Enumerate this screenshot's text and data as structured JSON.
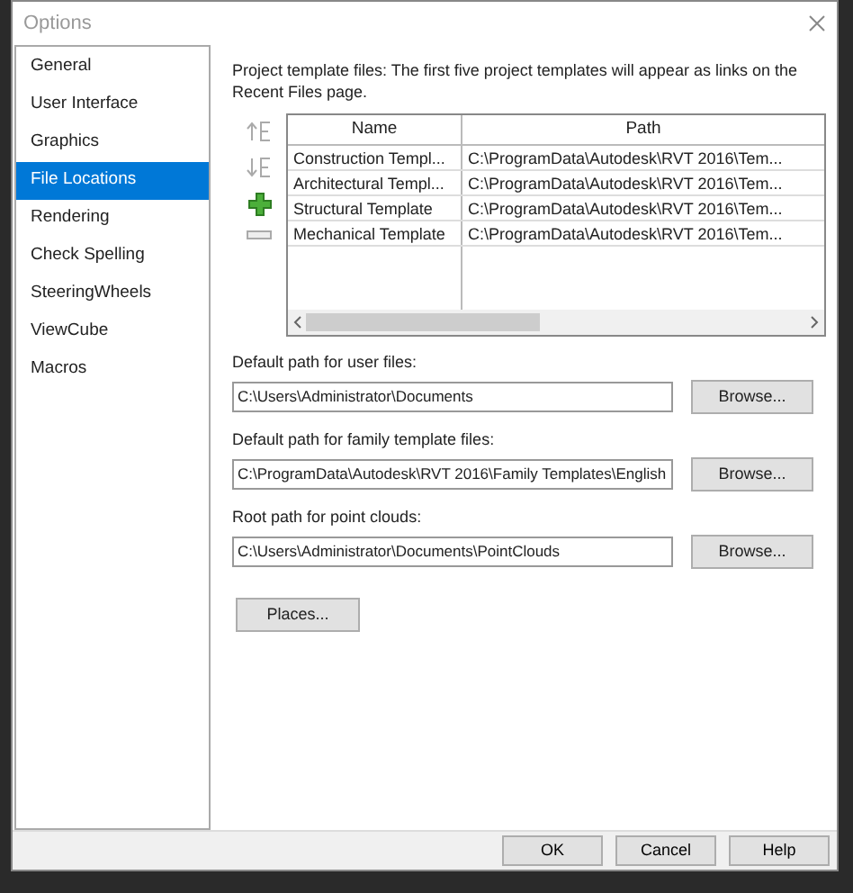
{
  "window": {
    "title": "Options"
  },
  "sidebar": {
    "items": [
      {
        "label": "General",
        "selected": false
      },
      {
        "label": "User Interface",
        "selected": false
      },
      {
        "label": "Graphics",
        "selected": false
      },
      {
        "label": "File Locations",
        "selected": true
      },
      {
        "label": "Rendering",
        "selected": false
      },
      {
        "label": "Check Spelling",
        "selected": false
      },
      {
        "label": "SteeringWheels",
        "selected": false
      },
      {
        "label": "ViewCube",
        "selected": false
      },
      {
        "label": "Macros",
        "selected": false
      }
    ]
  },
  "project_templates": {
    "description": "Project template files:  The first five project templates will appear as links on the Recent Files page.",
    "table": {
      "columns": [
        "Name",
        "Path"
      ],
      "rows": [
        [
          "Construction Templ...",
          "C:\\ProgramData\\Autodesk\\RVT 2016\\Tem..."
        ],
        [
          "Architectural Templ...",
          "C:\\ProgramData\\Autodesk\\RVT 2016\\Tem..."
        ],
        [
          "Structural Template",
          "C:\\ProgramData\\Autodesk\\RVT 2016\\Tem..."
        ],
        [
          "Mechanical Template",
          "C:\\ProgramData\\Autodesk\\RVT 2016\\Tem..."
        ]
      ]
    }
  },
  "paths": [
    {
      "label": "Default path for user files:",
      "value": "C:\\Users\\Administrator\\Documents",
      "button": "Browse..."
    },
    {
      "label": "Default path for family template files:",
      "value": "C:\\ProgramData\\Autodesk\\RVT 2016\\Family Templates\\English",
      "button": "Browse..."
    },
    {
      "label": "Root path for point clouds:",
      "value": "C:\\Users\\Administrator\\Documents\\PointClouds",
      "button": "Browse..."
    }
  ],
  "places_button": "Places...",
  "buttons": [
    "OK",
    "Cancel",
    "Help"
  ]
}
